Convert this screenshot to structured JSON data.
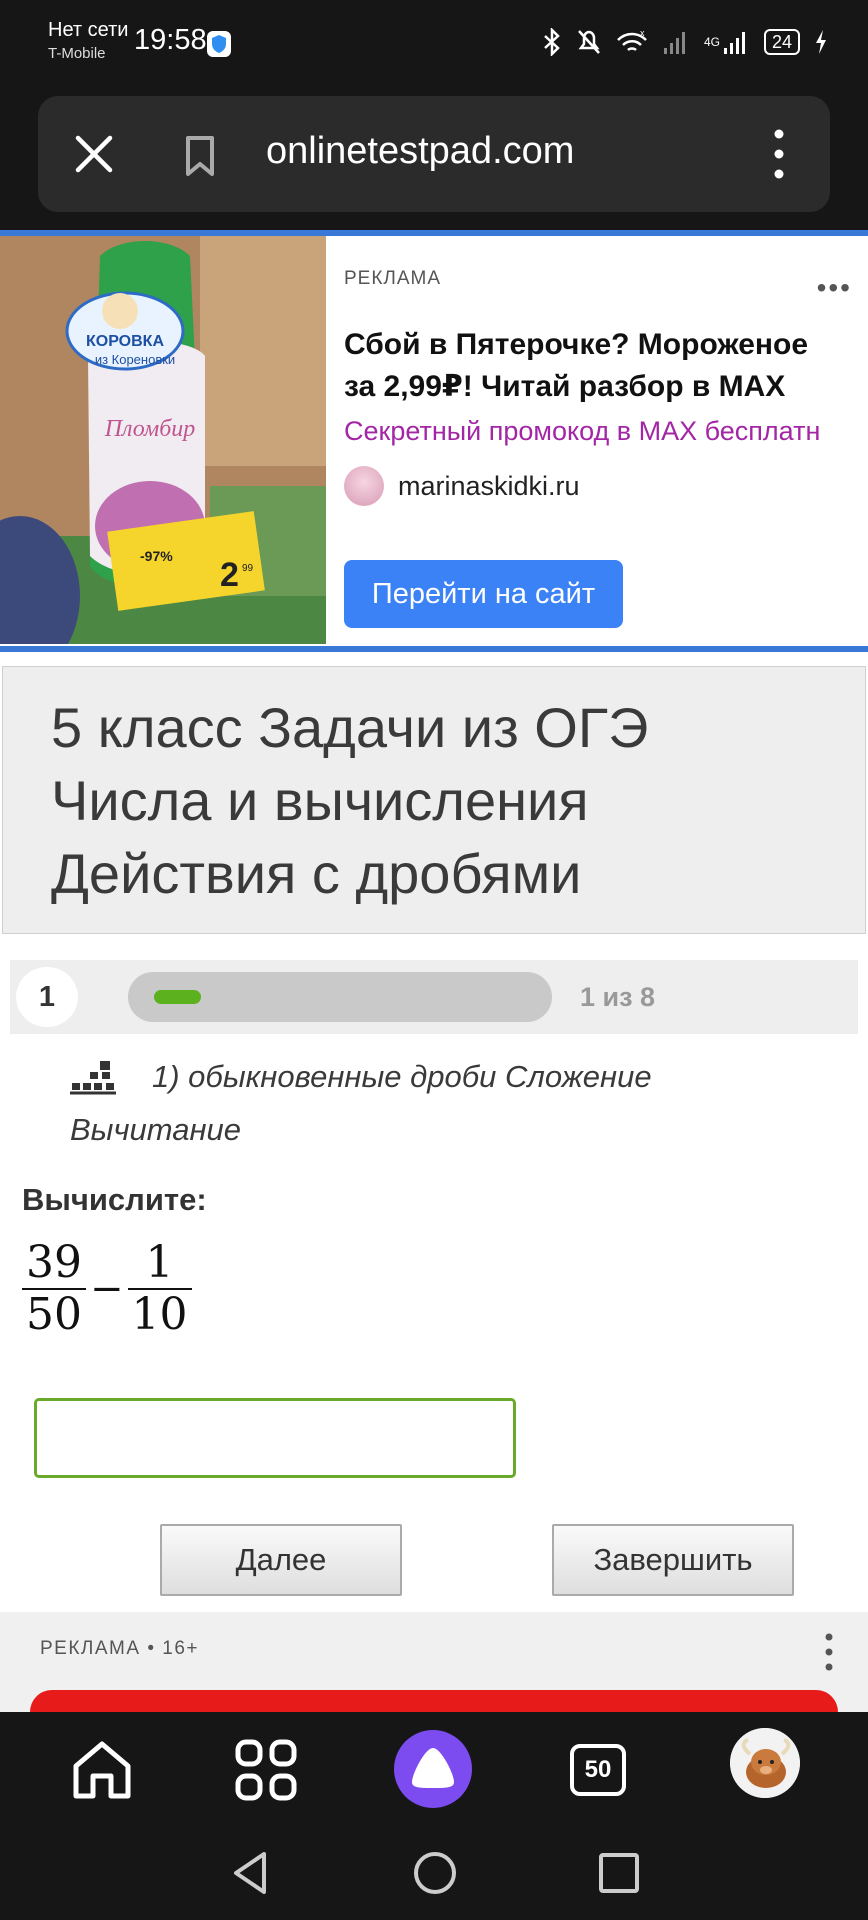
{
  "status_bar": {
    "network": "Нет сети",
    "operator": "T-Mobile",
    "time": "19:58",
    "network_type": "4G",
    "battery": "24"
  },
  "browser": {
    "url": "onlinetestpad.com"
  },
  "ad_top": {
    "label": "РЕКЛАМА",
    "title": "Сбой в Пятерочке? Мороженое за 2,99₽! Читай разбор в MAX",
    "promo": "Секретный промокод в MAX бесплатн",
    "site": "marinaskidki.ru",
    "button": "Перейти на сайт",
    "image_texts": {
      "brand1": "КОРОВКА",
      "brand2": "из Кореновки",
      "product": "Пломбир",
      "price_main": "2",
      "price_small": "99",
      "discount": "-97%"
    }
  },
  "test": {
    "title_line1": "5 класс Задачи из ОГЭ",
    "title_line2": "Числа и вычисления",
    "title_line3": "Действия с дробями",
    "question_number": "1",
    "progress_text": "1 из 8",
    "progress_fraction": 0.125,
    "category": "1) обыкновенные дроби Сложение Вычитание",
    "prompt": "Вычислите:",
    "fraction1_num": "39",
    "fraction1_den": "50",
    "operator": "−",
    "fraction2_num": "1",
    "fraction2_den": "10",
    "answer_value": "",
    "next_button": "Далее",
    "finish_button": "Завершить"
  },
  "ad_bottom": {
    "label": "РЕКЛАМА • 16+"
  },
  "bottom_nav": {
    "tabs_count": "50"
  },
  "colors": {
    "accent_blue": "#3a78d8",
    "ad_button": "#3b82f6",
    "promo_purple": "#a326a6",
    "progress_green": "#5cb21e",
    "input_border": "#6aaa2a",
    "alice_purple": "#7d4cf0",
    "ad_red": "#e81b1b"
  }
}
